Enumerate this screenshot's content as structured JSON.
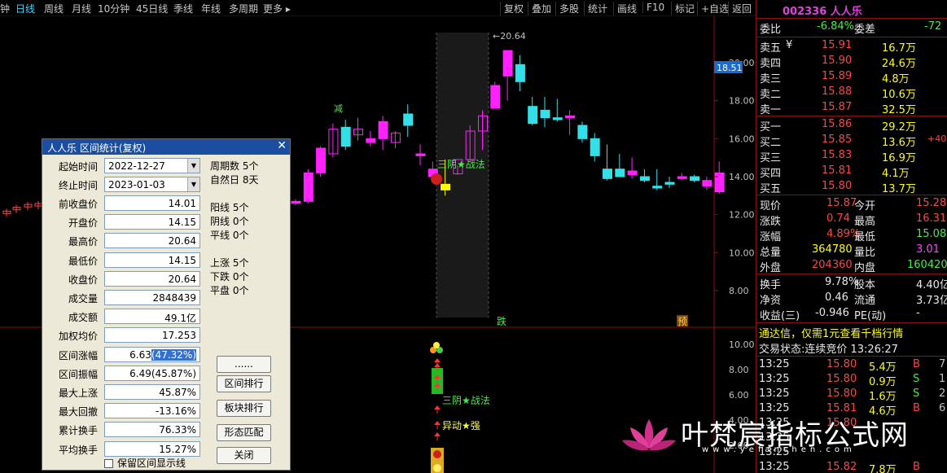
{
  "toolbar": {
    "left": [
      "钟",
      "日线",
      "周线",
      "月线",
      "10分钟",
      "45日线",
      "季线",
      "年线",
      "多周期",
      "更多 ▸"
    ],
    "active": "日线",
    "right": [
      "复权",
      "叠加",
      "多股",
      "统计",
      "画线",
      "F10",
      "标记",
      "+自选",
      "返回"
    ]
  },
  "chart": {
    "y_ticks": [
      "20.00",
      "18.00",
      "16.00",
      "14.00",
      "12.00",
      "10.00",
      "8.00"
    ],
    "price_tag": "18.51",
    "high_label": "20.64",
    "vol_ticks": [
      "10.00",
      "8.00",
      "6.00",
      "4.00",
      "2.00"
    ],
    "annot_jian": "减",
    "annot_sanyin": "三阴★战法",
    "annot_die": "跌",
    "annot_yu": "预",
    "annot_sanyin2": "三阴★战法",
    "annot_yidong": "异动★强"
  },
  "chart_data": {
    "type": "candlestick",
    "ohlc": [
      [
        12.6,
        12.8,
        12.5,
        12.7
      ],
      [
        12.7,
        14.4,
        12.6,
        14.2
      ],
      [
        14.2,
        15.6,
        14.0,
        15.5
      ],
      [
        15.2,
        16.8,
        15.0,
        16.5
      ],
      [
        16.6,
        17.0,
        15.4,
        15.6
      ],
      [
        16.2,
        17.1,
        15.9,
        16.5
      ],
      [
        15.8,
        16.4,
        15.6,
        16.0
      ],
      [
        16.0,
        17.2,
        15.4,
        16.9
      ],
      [
        15.8,
        16.4,
        15.5,
        16.3
      ],
      [
        17.3,
        17.8,
        16.1,
        16.7
      ],
      [
        15.1,
        15.7,
        14.6,
        15.2
      ],
      [
        14.4,
        14.8,
        13.8,
        14.0
      ],
      [
        13.3,
        14.9,
        13.0,
        13.6
      ],
      [
        14.15,
        14.6,
        14.1,
        14.9
      ],
      [
        14.9,
        16.7,
        14.8,
        16.4
      ],
      [
        16.4,
        17.5,
        15.4,
        17.2
      ],
      [
        17.6,
        19.0,
        17.6,
        18.8
      ],
      [
        19.3,
        20.64,
        18.0,
        20.64
      ],
      [
        19.9,
        20.4,
        18.5,
        19.0
      ],
      [
        17.7,
        18.2,
        16.7,
        16.8
      ],
      [
        17.5,
        18.2,
        16.6,
        17.1
      ],
      [
        17.1,
        18.1,
        16.9,
        17.0
      ],
      [
        17.1,
        17.5,
        16.2,
        17.2
      ],
      [
        16.7,
        16.9,
        15.8,
        16.0
      ],
      [
        16.0,
        16.3,
        14.8,
        15.1
      ],
      [
        14.4,
        15.7,
        13.8,
        13.9
      ],
      [
        14.4,
        15.2,
        14.0,
        14.0
      ],
      [
        14.1,
        15.0,
        13.9,
        14.3
      ],
      [
        14.0,
        14.4,
        13.7,
        13.8
      ],
      [
        13.5,
        14.4,
        13.3,
        13.4
      ],
      [
        13.7,
        14.0,
        13.4,
        13.6
      ],
      [
        13.9,
        14.2,
        13.8,
        14.0
      ],
      [
        14.0,
        14.1,
        13.7,
        13.8
      ],
      [
        13.5,
        14.0,
        13.3,
        13.8
      ],
      [
        13.2,
        14.8,
        13.1,
        14.2
      ]
    ],
    "ylim": [
      6.8,
      21.5
    ]
  },
  "dialog": {
    "title": "人人乐 区间统计(复权)",
    "start_label": "起始时间",
    "start_value": "2022-12-27",
    "end_label": "终止时间",
    "end_value": "2023-01-03",
    "fields": [
      {
        "label": "前收盘价",
        "value": "14.01"
      },
      {
        "label": "开盘价",
        "value": "14.15"
      },
      {
        "label": "最高价",
        "value": "20.64"
      },
      {
        "label": "最低价",
        "value": "14.15"
      },
      {
        "label": "收盘价",
        "value": "20.64"
      },
      {
        "label": "成交量",
        "value": "2848439"
      },
      {
        "label": "成交额",
        "value": "49.1亿"
      },
      {
        "label": "加权均价",
        "value": "17.253"
      },
      {
        "label": "区间涨幅",
        "value_a": "6.63",
        "value_b": "(47.32%)"
      },
      {
        "label": "区间振幅",
        "value": "6.49(45.87%)"
      },
      {
        "label": "最大上涨",
        "value": "45.87%"
      },
      {
        "label": "最大回撤",
        "value": "-13.16%"
      },
      {
        "label": "累计换手",
        "value": "76.33%"
      },
      {
        "label": "平均换手",
        "value": "15.27%"
      }
    ],
    "info": [
      "周期数 5个",
      "自然日 8天",
      "阳线 5个",
      "阴线 0个",
      "平线 0个",
      "上涨 5个",
      "下跌 0个",
      "平盘 0个"
    ],
    "buttons": [
      "......",
      "区间排行",
      "板块排行",
      "形态匹配",
      "关闭"
    ],
    "checkbox": "保留区间显示线"
  },
  "panel": {
    "code": "002336 人人乐",
    "weibi_label": "委比",
    "weibi_value": "-6.84%",
    "weicha_label": "委差",
    "weicha_value": "-72",
    "sell": [
      {
        "label": "卖五",
        "price": "15.91",
        "vol": "16.7万"
      },
      {
        "label": "卖四",
        "price": "15.90",
        "vol": "24.6万"
      },
      {
        "label": "卖三",
        "price": "15.89",
        "vol": "4.8万"
      },
      {
        "label": "卖二",
        "price": "15.88",
        "vol": "10.6万"
      },
      {
        "label": "卖一",
        "price": "15.87",
        "vol": "32.5万"
      }
    ],
    "sell_mark": "¥",
    "buy": [
      {
        "label": "买一",
        "price": "15.86",
        "vol": "29.2万"
      },
      {
        "label": "买二",
        "price": "15.85",
        "vol": "13.6万",
        "extra": "+40"
      },
      {
        "label": "买三",
        "price": "15.83",
        "vol": "16.9万"
      },
      {
        "label": "买四",
        "price": "15.81",
        "vol": "4.1万"
      },
      {
        "label": "买五",
        "price": "15.80",
        "vol": "13.7万"
      }
    ],
    "stats": [
      {
        "l1": "现价",
        "v1": "15.87",
        "l2": "今开",
        "v2": "15.28"
      },
      {
        "l1": "涨跌",
        "v1": "0.74",
        "l2": "最高",
        "v2": "16.31"
      },
      {
        "l1": "涨幅",
        "v1": "4.89%",
        "l2": "最低",
        "v2": "15.08"
      },
      {
        "l1": "总量",
        "v1": "364780",
        "l2": "量比",
        "v2": "3.01"
      },
      {
        "l1": "外盘",
        "v1": "204360",
        "l2": "内盘",
        "v2": "160420"
      }
    ],
    "stats2": [
      {
        "l1": "换手",
        "v1": "9.78%",
        "l2": "股本",
        "v2": "4.40亿"
      },
      {
        "l1": "净资",
        "v1": "0.46",
        "l2": "流通",
        "v2": "3.73亿"
      },
      {
        "l1": "收益(三)",
        "v1": "-0.946",
        "l2": "PE(动)",
        "v2": "-"
      }
    ],
    "promo": "通达信，仅需1元查看千档行情",
    "status": "交易状态:连续竞价 13:26:27",
    "trades": [
      {
        "t": "13:25",
        "p": "15.80",
        "v": "5.4万",
        "d": "B",
        "n": "7"
      },
      {
        "t": "13:25",
        "p": "15.80",
        "v": "0.9万",
        "d": "S",
        "n": "1"
      },
      {
        "t": "13:25",
        "p": "15.80",
        "v": "1.6万",
        "d": "S",
        "n": "2"
      },
      {
        "t": "13:25",
        "p": "15.81",
        "v": "4.6万",
        "d": "B",
        "n": "6"
      },
      {
        "t": "13:25",
        "p": "15.80",
        "v": "",
        "d": "",
        "n": ""
      },
      {
        "t": "13:25",
        "p": "",
        "v": "",
        "d": "",
        "n": ""
      },
      {
        "t": "13:25",
        "p": "",
        "v": "",
        "d": "",
        "n": ""
      },
      {
        "t": "13:25",
        "p": "15.82",
        "v": "7.8万",
        "d": "B",
        "n": ""
      }
    ]
  },
  "watermark": {
    "big": "叶梵宸指标公式网",
    "small": "www.yefanchen.com"
  }
}
